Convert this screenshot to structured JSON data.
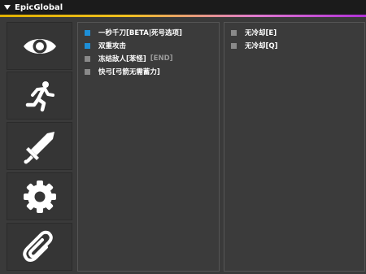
{
  "window": {
    "title": "EpicGlobal"
  },
  "sidebar": {
    "items": [
      {
        "name": "visuals",
        "icon": "eye-icon"
      },
      {
        "name": "movement",
        "icon": "running-person-icon"
      },
      {
        "name": "combat",
        "icon": "sword-icon"
      },
      {
        "name": "settings",
        "icon": "gear-icon"
      },
      {
        "name": "misc",
        "icon": "paperclip-icon"
      }
    ]
  },
  "left_panel": {
    "options": [
      {
        "label": "一秒千刀[BETA|死号选项]",
        "enabled": true,
        "keybind": ""
      },
      {
        "label": "双重攻击",
        "enabled": true,
        "keybind": ""
      },
      {
        "label": "冻结敌人[苯怪]",
        "enabled": false,
        "keybind": "[END]"
      },
      {
        "label": "快弓[弓箭无需蓄力]",
        "enabled": false,
        "keybind": ""
      }
    ]
  },
  "right_panel": {
    "options": [
      {
        "label": "无冷却[E]",
        "enabled": false
      },
      {
        "label": "无冷却[Q]",
        "enabled": false
      }
    ]
  },
  "colors": {
    "checkbox_on": "#1d8fd8",
    "checkbox_off": "#8a8a8a",
    "accent_start": "#e0b000",
    "accent_end": "#b030d8"
  }
}
